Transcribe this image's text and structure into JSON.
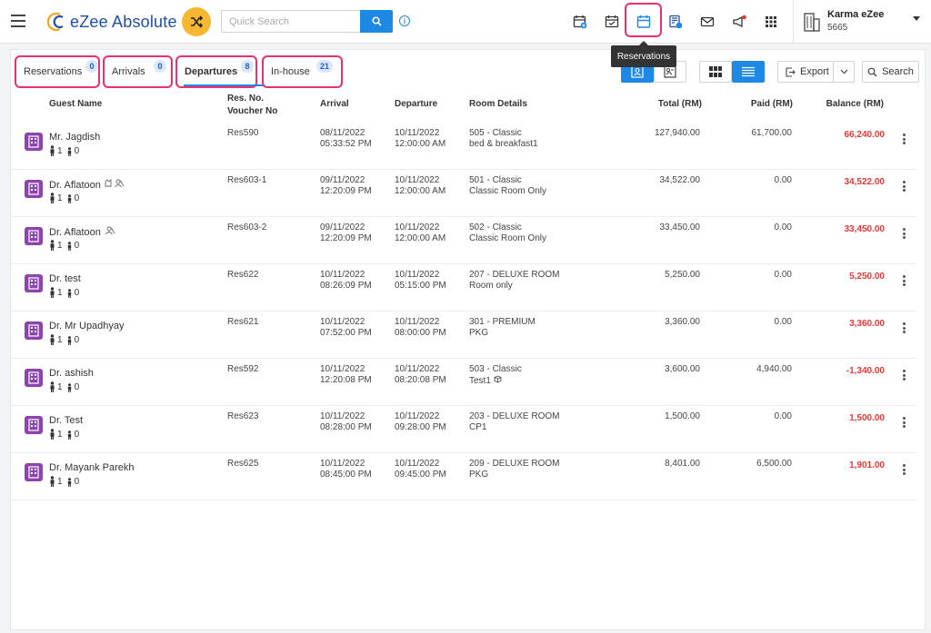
{
  "header": {
    "logo_text": "eZee Absolute",
    "search_placeholder": "Quick Search",
    "info_label": "i",
    "tooltip": "Reservations",
    "user_name": "Karma eZee",
    "user_id": "5665"
  },
  "tabs": [
    {
      "label": "Reservations",
      "count": "0"
    },
    {
      "label": "Arrivals",
      "count": "0"
    },
    {
      "label": "Departures",
      "count": "8"
    },
    {
      "label": "In-house",
      "count": "21"
    }
  ],
  "toolbar": {
    "export_label": "Export",
    "search_label": "Search"
  },
  "table": {
    "headers": {
      "guest": "Guest Name",
      "res": "Res. No.",
      "voucher": "Voucher No",
      "arrival": "Arrival",
      "departure": "Departure",
      "room": "Room Details",
      "total": "Total (RM)",
      "paid": "Paid (RM)",
      "balance": "Balance (RM)"
    },
    "rows": [
      {
        "name": "Mr. Jagdish",
        "adults": "1",
        "children": "0",
        "res": "Res590",
        "arr_date": "08/11/2022",
        "arr_time": "05:33:52 PM",
        "dep_date": "10/11/2022",
        "dep_time": "12:00:00 AM",
        "room": "505 - Classic",
        "plan": "bed & breakfast1",
        "total": "127,940.00",
        "paid": "61,700.00",
        "balance": "66,240.00"
      },
      {
        "name": "Dr. Aflatoon",
        "adults": "1",
        "children": "0",
        "res": "Res603-1",
        "arr_date": "09/11/2022",
        "arr_time": "12:20:09 PM",
        "dep_date": "10/11/2022",
        "dep_time": "12:00:00 AM",
        "room": "501 - Classic",
        "plan": "Classic Room Only",
        "total": "34,522.00",
        "paid": "0.00",
        "balance": "34,522.00"
      },
      {
        "name": "Dr. Aflatoon",
        "adults": "1",
        "children": "0",
        "res": "Res603-2",
        "arr_date": "09/11/2022",
        "arr_time": "12:20:09 PM",
        "dep_date": "10/11/2022",
        "dep_time": "12:00:00 AM",
        "room": "502 - Classic",
        "plan": "Classic Room Only",
        "total": "33,450.00",
        "paid": "0.00",
        "balance": "33,450.00"
      },
      {
        "name": "Dr. test",
        "adults": "1",
        "children": "0",
        "res": "Res622",
        "arr_date": "10/11/2022",
        "arr_time": "08:26:09 PM",
        "dep_date": "10/11/2022",
        "dep_time": "05:15:00 PM",
        "room": "207 - DELUXE ROOM",
        "plan": "Room only",
        "total": "5,250.00",
        "paid": "0.00",
        "balance": "5,250.00"
      },
      {
        "name": "Dr. Mr Upadhyay",
        "adults": "1",
        "children": "0",
        "res": "Res621",
        "arr_date": "10/11/2022",
        "arr_time": "07:52:00 PM",
        "dep_date": "10/11/2022",
        "dep_time": "08:00:00 PM",
        "room": "301 - PREMIUM",
        "plan": "PKG",
        "total": "3,360.00",
        "paid": "0.00",
        "balance": "3,360.00"
      },
      {
        "name": "Dr. ashish",
        "adults": "1",
        "children": "0",
        "res": "Res592",
        "arr_date": "10/11/2022",
        "arr_time": "12:20:08 PM",
        "dep_date": "10/11/2022",
        "dep_time": "08:20:08 PM",
        "room": "503 - Classic",
        "plan": "Test1",
        "total": "3,600.00",
        "paid": "4,940.00",
        "balance": "-1,340.00"
      },
      {
        "name": "Dr. Test",
        "adults": "1",
        "children": "0",
        "res": "Res623",
        "arr_date": "10/11/2022",
        "arr_time": "08:28:00 PM",
        "dep_date": "10/11/2022",
        "dep_time": "09:28:00 PM",
        "room": "203 - DELUXE ROOM",
        "plan": "CP1",
        "total": "1,500.00",
        "paid": "0.00",
        "balance": "1,500.00"
      },
      {
        "name": "Dr. Mayank Parekh",
        "adults": "1",
        "children": "0",
        "res": "Res625",
        "arr_date": "10/11/2022",
        "arr_time": "08:45:00 PM",
        "dep_date": "10/11/2022",
        "dep_time": "09:45:00 PM",
        "room": "209 - DELUXE ROOM",
        "plan": "PKG",
        "total": "8,401.00",
        "paid": "6,500.00",
        "balance": "1,901.00"
      }
    ]
  },
  "colors": {
    "accent": "#1e88e5",
    "highlight": "#e8306a",
    "balance": "#e53935",
    "guest_icon": "#8e44ad",
    "shuffle": "#f7b731"
  }
}
